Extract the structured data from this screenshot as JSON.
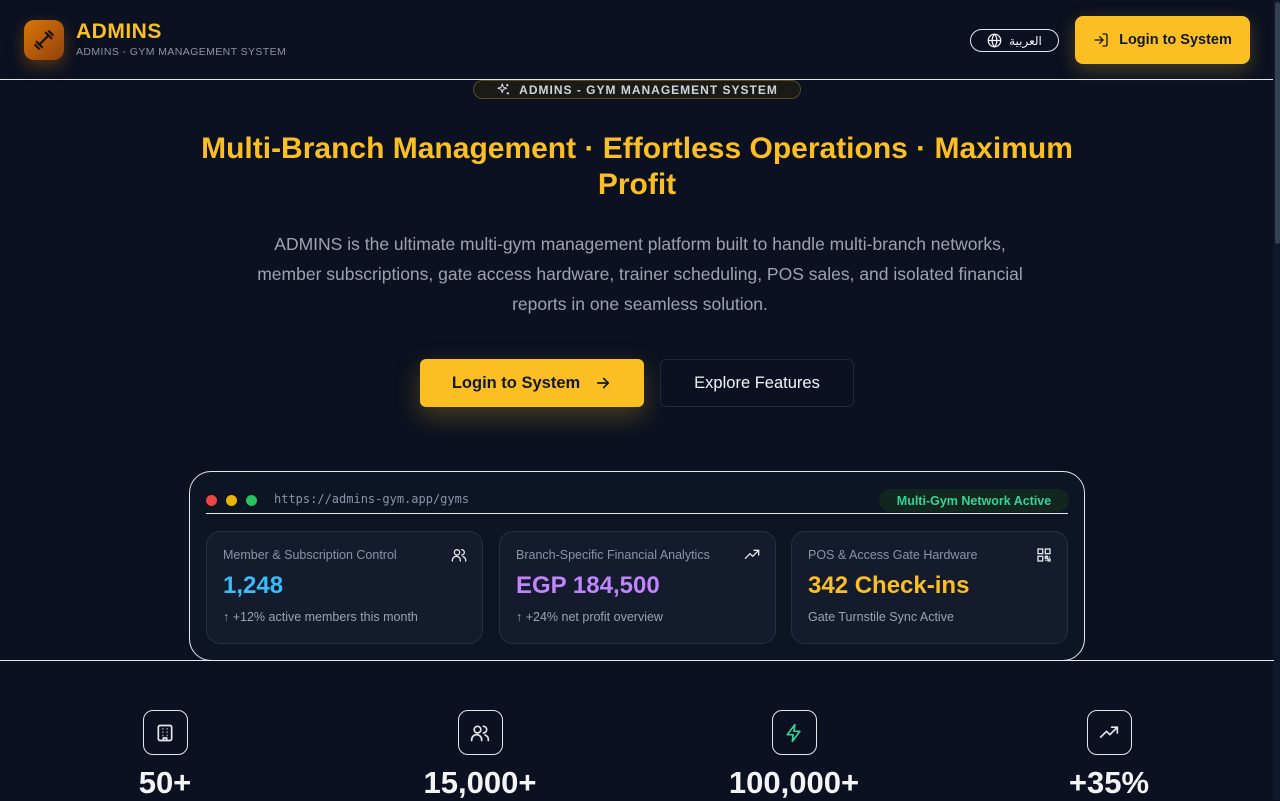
{
  "header": {
    "brand_title": "ADMINS",
    "brand_subtitle": "ADMINS - GYM MANAGEMENT SYSTEM",
    "language_label": "العربية",
    "login_label": "Login to System"
  },
  "hero": {
    "badge_label": "ADMINS - GYM MANAGEMENT SYSTEM",
    "title": "Multi-Branch Management · Effortless Operations · Maximum Profit",
    "description": "ADMINS is the ultimate multi-gym management platform built to handle multi-branch networks, member subscriptions, gate access hardware, trainer scheduling, POS sales, and isolated financial reports in one seamless solution.",
    "primary_cta": "Login to System",
    "secondary_cta": "Explore Features"
  },
  "preview": {
    "url": "https://admins-gym.app/gyms",
    "status_badge": "Multi-Gym Network Active",
    "cards": [
      {
        "title": "Member & Subscription Control",
        "value": "1,248",
        "note": "↑ +12% active members this month",
        "icon": "users-icon",
        "color": "#38bdf8"
      },
      {
        "title": "Branch-Specific Financial Analytics",
        "value": "EGP 184,500",
        "note": "↑ +24% net profit overview",
        "icon": "trending-up-icon",
        "color": "#c084fc"
      },
      {
        "title": "POS & Access Gate Hardware",
        "value": "342 Check-ins",
        "note": "Gate Turnstile Sync Active",
        "icon": "qr-code-icon",
        "color": "#fbbf24"
      }
    ]
  },
  "stats": [
    {
      "value": "50+",
      "icon": "building-icon"
    },
    {
      "value": "15,000+",
      "icon": "users-icon"
    },
    {
      "value": "100,000+",
      "icon": "bolt-icon"
    },
    {
      "value": "+35%",
      "icon": "trending-up-icon"
    }
  ],
  "colors": {
    "accent": "#fbbf24",
    "background": "#0b1120",
    "success": "#34d399",
    "dot_red": "#ef4444",
    "dot_yellow": "#eab308",
    "dot_green": "#22c55e"
  }
}
